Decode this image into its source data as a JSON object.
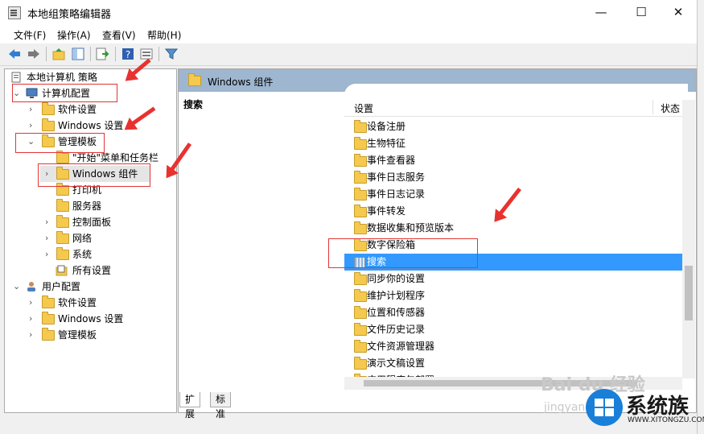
{
  "window": {
    "title": "本地组策略编辑器",
    "minimize": "—",
    "maximize": "☐",
    "close": "✕"
  },
  "menu": [
    "文件(F)",
    "操作(A)",
    "查看(V)",
    "帮助(H)"
  ],
  "tree": {
    "root": "本地计算机 策略",
    "computer_config": "计算机配置",
    "software_settings": "软件设置",
    "windows_settings": "Windows 设置",
    "admin_templates": "管理模板",
    "start_menu": "\"开始\"菜单和任务栏",
    "windows_components": "Windows 组件",
    "printers": "打印机",
    "servers": "服务器",
    "control_panel": "控制面板",
    "network": "网络",
    "system": "系统",
    "all_settings": "所有设置",
    "user_config": "用户配置",
    "user_software_settings": "软件设置",
    "user_windows_settings": "Windows 设置",
    "user_admin_templates": "管理模板"
  },
  "right": {
    "header": "Windows 组件",
    "description_title": "搜索",
    "col_setting": "设置",
    "col_state": "状态",
    "items": [
      "设备注册",
      "生物特征",
      "事件查看器",
      "事件日志服务",
      "事件日志记录",
      "事件转发",
      "数据收集和预览版本",
      "数字保险箱",
      "搜索",
      "同步你的设置",
      "维护计划程序",
      "位置和传感器",
      "文件历史记录",
      "文件资源管理器",
      "演示文稿设置",
      "应用程序包部署"
    ],
    "selected_index": 8
  },
  "tabs": [
    "扩展",
    "标准"
  ],
  "watermark": {
    "baidu": "Bai du 经验",
    "url": "jingyan"
  },
  "brand": {
    "name": "系统族",
    "url": "WWW.XITONGZU.COM"
  }
}
